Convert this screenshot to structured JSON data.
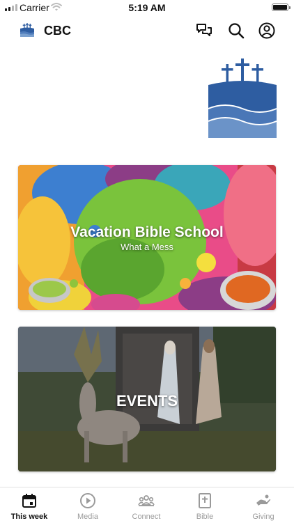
{
  "status_bar": {
    "carrier": "Carrier",
    "time": "5:19 AM"
  },
  "nav": {
    "title": "CBC",
    "icons": [
      "chat-icon",
      "search-icon",
      "account-icon"
    ]
  },
  "cards": [
    {
      "title": "Vacation Bible School",
      "subtitle": "What a Mess"
    },
    {
      "title": "EVENTS"
    }
  ],
  "tabs": [
    {
      "label": "This week",
      "icon": "calendar-icon",
      "active": true
    },
    {
      "label": "Media",
      "icon": "play-icon",
      "active": false
    },
    {
      "label": "Connect",
      "icon": "people-icon",
      "active": false
    },
    {
      "label": "Bible",
      "icon": "bible-icon",
      "active": false
    },
    {
      "label": "Giving",
      "icon": "giving-icon",
      "active": false
    }
  ],
  "colors": {
    "logo_blue": "#2e5da1",
    "logo_light": "#5b86c0",
    "active_tab": "#111111",
    "inactive_tab": "#9a9a9a"
  }
}
